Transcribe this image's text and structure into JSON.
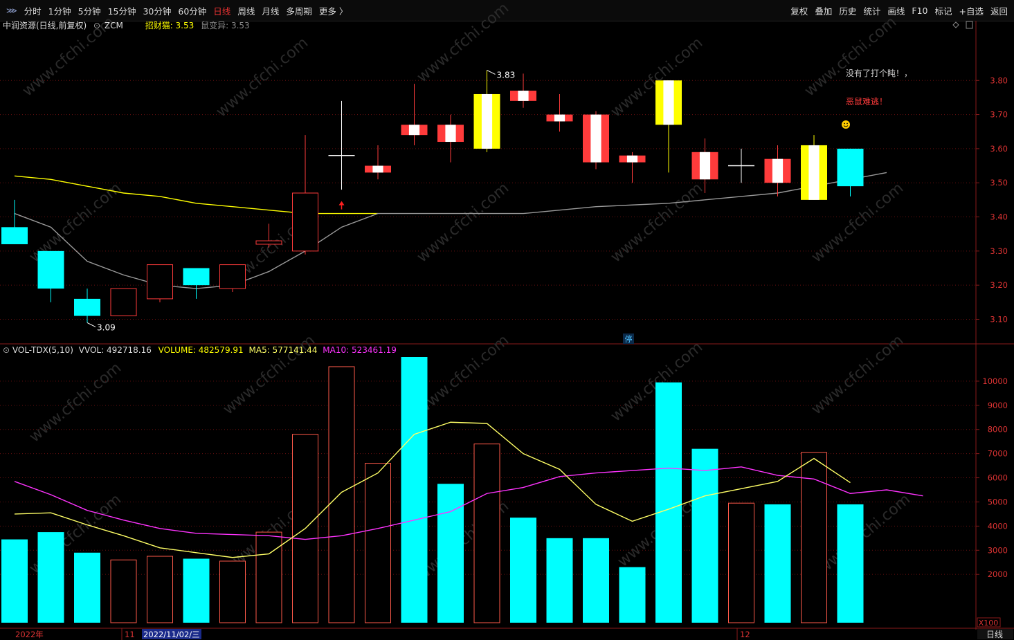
{
  "toolbar": {
    "left": [
      "分时",
      "1分钟",
      "5分钟",
      "15分钟",
      "30分钟",
      "60分钟",
      "日线",
      "周线",
      "月线",
      "多周期",
      "更多 〉"
    ],
    "active": "日线",
    "right": [
      "复权",
      "叠加",
      "历史",
      "统计",
      "画线",
      "F10",
      "标记",
      "+自选",
      "返回"
    ]
  },
  "main_header": {
    "title": "中润资源(日线,前复权)",
    "code": "ZCM",
    "indicator1": "招财猫: 3.53",
    "indicator2": "鼠变异: 3.53"
  },
  "vol_header": {
    "name": "VOL-TDX(5,10)",
    "vvol": "VVOL: 492718.16",
    "volume": "VOLUME: 482579.91",
    "ma5": "MA5: 577141.44",
    "ma10": "MA10: 523461.19"
  },
  "annotations": {
    "note1": "没有了打个盹！，",
    "note2": "恶鼠难逃！",
    "low_label": "3.09",
    "high_label": "3.83",
    "mid_marker": "停"
  },
  "date_axis": {
    "year": "2022年",
    "month11": "11",
    "cursor_date": "2022/11/02/三",
    "month12": "12",
    "period_label": "日线"
  },
  "vol_scale_label": "X100",
  "watermark": "www.cfchi.com",
  "colors": {
    "up": "#ff3b3b",
    "down": "#00ffff",
    "highlight_up": "#ffff00",
    "ma_yellow": "#ffff00",
    "ma_gray": "#9a9a9a",
    "vol_ma5": "#ffff66",
    "vol_ma10": "#ff33ff",
    "grid": "#6a1010",
    "note1": "#cccccc",
    "note2": "#ff3b3b"
  },
  "chart_data": [
    {
      "type": "candlestick",
      "title": "中润资源(日线,前复权)",
      "ylim": [
        3.03,
        3.91
      ],
      "y_ticks": [
        3.1,
        3.2,
        3.3,
        3.4,
        3.5,
        3.6,
        3.7,
        3.8
      ],
      "candles": [
        {
          "o": 3.32,
          "c": 3.37,
          "h": 3.45,
          "l": 3.32,
          "dir": "down",
          "style": "solid"
        },
        {
          "o": 3.3,
          "c": 3.19,
          "h": 3.3,
          "l": 3.15,
          "dir": "down",
          "style": "solid"
        },
        {
          "o": 3.16,
          "c": 3.11,
          "h": 3.19,
          "l": 3.09,
          "dir": "down",
          "style": "solid"
        },
        {
          "o": 3.11,
          "c": 3.19,
          "h": 3.19,
          "l": 3.11,
          "dir": "up",
          "style": "hollow"
        },
        {
          "o": 3.16,
          "c": 3.26,
          "h": 3.26,
          "l": 3.15,
          "dir": "up",
          "style": "hollow"
        },
        {
          "o": 3.25,
          "c": 3.2,
          "h": 3.25,
          "l": 3.16,
          "dir": "down",
          "style": "solid"
        },
        {
          "o": 3.19,
          "c": 3.26,
          "h": 3.26,
          "l": 3.18,
          "dir": "up",
          "style": "hollow"
        },
        {
          "o": 3.32,
          "c": 3.33,
          "h": 3.38,
          "l": 3.31,
          "dir": "up",
          "style": "hollow"
        },
        {
          "o": 3.3,
          "c": 3.47,
          "h": 3.64,
          "l": 3.29,
          "dir": "up",
          "style": "hollow"
        },
        {
          "o": 3.58,
          "c": 3.58,
          "h": 3.74,
          "l": 3.48,
          "dir": "flat",
          "style": "cross"
        },
        {
          "o": 3.53,
          "c": 3.55,
          "h": 3.61,
          "l": 3.51,
          "dir": "up",
          "style": "redwhite"
        },
        {
          "o": 3.64,
          "c": 3.67,
          "h": 3.79,
          "l": 3.61,
          "dir": "up",
          "style": "redwhite"
        },
        {
          "o": 3.67,
          "c": 3.62,
          "h": 3.7,
          "l": 3.56,
          "dir": "up",
          "style": "redwhite"
        },
        {
          "o": 3.6,
          "c": 3.76,
          "h": 3.83,
          "l": 3.59,
          "dir": "up",
          "style": "yellowwhite"
        },
        {
          "o": 3.77,
          "c": 3.74,
          "h": 3.82,
          "l": 3.72,
          "dir": "up",
          "style": "redwhite"
        },
        {
          "o": 3.7,
          "c": 3.68,
          "h": 3.76,
          "l": 3.65,
          "dir": "up",
          "style": "redwhite"
        },
        {
          "o": 3.7,
          "c": 3.56,
          "h": 3.71,
          "l": 3.54,
          "dir": "up",
          "style": "redwhite"
        },
        {
          "o": 3.58,
          "c": 3.56,
          "h": 3.59,
          "l": 3.5,
          "dir": "up",
          "style": "redwhite"
        },
        {
          "o": 3.8,
          "c": 3.67,
          "h": 3.8,
          "l": 3.53,
          "dir": "up",
          "style": "yellowwhite"
        },
        {
          "o": 3.51,
          "c": 3.59,
          "h": 3.63,
          "l": 3.47,
          "dir": "up",
          "style": "redwhite"
        },
        {
          "o": 3.55,
          "c": 3.55,
          "h": 3.6,
          "l": 3.5,
          "dir": "flat",
          "style": "cross"
        },
        {
          "o": 3.5,
          "c": 3.57,
          "h": 3.61,
          "l": 3.46,
          "dir": "up",
          "style": "redwhite"
        },
        {
          "o": 3.45,
          "c": 3.61,
          "h": 3.64,
          "l": 3.45,
          "dir": "up",
          "style": "yellowwhite"
        },
        {
          "o": 3.6,
          "c": 3.49,
          "h": 3.6,
          "l": 3.46,
          "dir": "down",
          "style": "solid"
        }
      ],
      "ma_yellow": [
        3.52,
        3.51,
        3.49,
        3.47,
        3.46,
        3.44,
        3.43,
        3.42,
        3.41,
        3.41,
        3.41
      ],
      "ma_gray": [
        3.41,
        3.37,
        3.27,
        3.23,
        3.2,
        3.19,
        3.2,
        3.24,
        3.3,
        3.37,
        3.41,
        3.41,
        3.41,
        3.41,
        3.41,
        3.42,
        3.43,
        3.435,
        3.44,
        3.45,
        3.46,
        3.47,
        3.49,
        3.51,
        3.53
      ]
    },
    {
      "type": "bar",
      "title": "VOL-TDX(5,10)",
      "ylim": [
        0,
        11000
      ],
      "y_ticks": [
        2000,
        3000,
        4000,
        5000,
        6000,
        7000,
        8000,
        9000,
        10000
      ],
      "volumes": [
        3450,
        3750,
        2900,
        2600,
        2750,
        2650,
        2550,
        3750,
        7800,
        10600,
        6600,
        11000,
        5750,
        7400,
        4350,
        3500,
        3500,
        2300,
        9950,
        7200,
        4950,
        4900,
        7050,
        4900
      ],
      "vol_dir": [
        "down",
        "down",
        "down",
        "up",
        "up",
        "down",
        "up",
        "up",
        "up",
        "up",
        "up",
        "down",
        "down",
        "up",
        "down",
        "down",
        "down",
        "down",
        "down",
        "down",
        "up",
        "down",
        "up",
        "down"
      ],
      "ma5": [
        4500,
        4550,
        4050,
        3600,
        3100,
        2900,
        2700,
        2850,
        3900,
        5400,
        6200,
        7800,
        8300,
        8250,
        7000,
        6350,
        4900,
        4200,
        4700,
        5250,
        5550,
        5850,
        6800,
        5800
      ],
      "ma10": [
        5850,
        5300,
        4650,
        4250,
        3900,
        3700,
        3650,
        3600,
        3450,
        3600,
        3900,
        4250,
        4600,
        5350,
        5600,
        6050,
        6200,
        6300,
        6400,
        6300,
        6450,
        6100,
        5950,
        5350,
        5500,
        5250
      ]
    }
  ]
}
